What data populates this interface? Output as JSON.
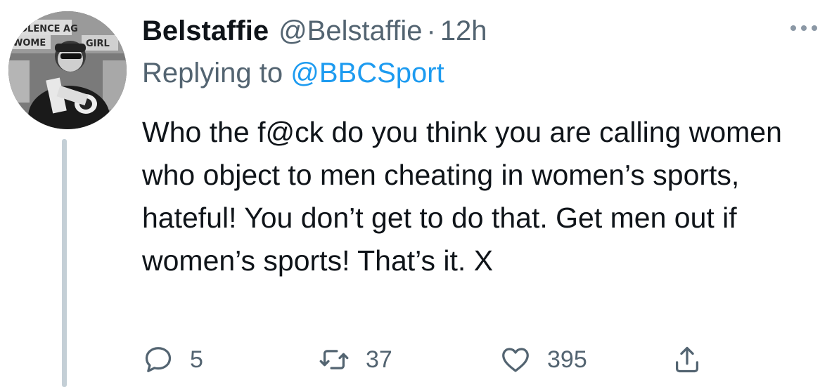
{
  "author": {
    "display_name": "Belstaffie",
    "handle": "@Belstaffie",
    "separator": "·",
    "time": "12h",
    "avatar_sign_text": [
      "OLENCE AG",
      "WOME",
      "GIRL"
    ]
  },
  "reply": {
    "prefix": "Replying to ",
    "mention": "@BBCSport"
  },
  "tweet": {
    "text": "Who the f@ck do you think you are calling women who object to men cheating in women’s sports, hateful! You don’t get to do that. Get men out if women’s sports! That’s it. X"
  },
  "actions": {
    "replies": "5",
    "retweets": "37",
    "likes": "395"
  },
  "colors": {
    "primary_text": "#0f1419",
    "secondary_text": "#536471",
    "mention": "#1d9bf0",
    "thread_line": "#c4cfd6"
  },
  "icons": [
    "more-icon",
    "reply-icon",
    "retweet-icon",
    "like-icon",
    "share-icon"
  ]
}
